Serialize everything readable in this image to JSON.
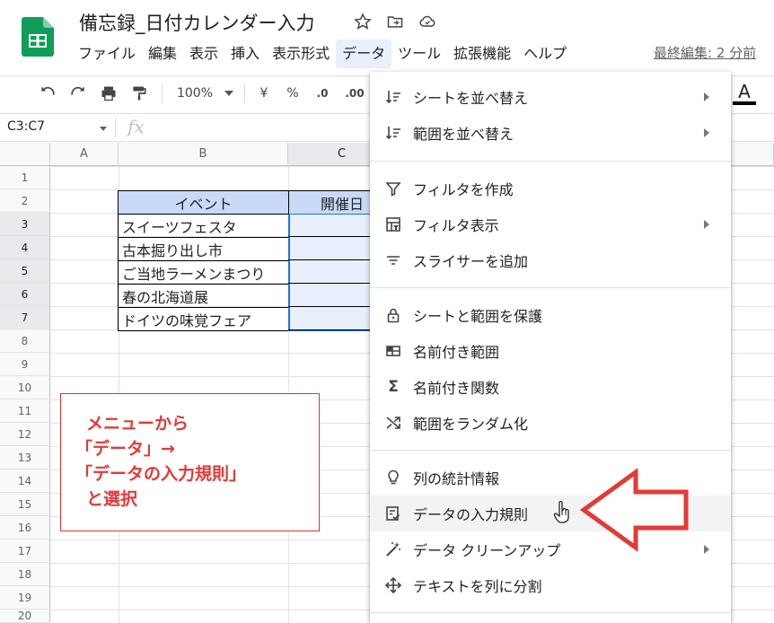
{
  "doc": {
    "title": "備忘録_日付カレンダー入力",
    "last_edit": "最終編集: 2 分前"
  },
  "menubar": [
    "ファイル",
    "編集",
    "表示",
    "挿入",
    "表示形式",
    "データ",
    "ツール",
    "拡張機能",
    "ヘルプ"
  ],
  "toolbar": {
    "zoom": "100%",
    "currency": "¥",
    "percent": "%",
    "dec_decrease": ".0",
    "dec_increase": ".00",
    "text_color": "A"
  },
  "formula_bar": {
    "name_box": "C3:C7",
    "fx": "fx"
  },
  "columns": [
    "A",
    "B",
    "C"
  ],
  "rows": [
    "1",
    "2",
    "3",
    "4",
    "5",
    "6",
    "7",
    "8",
    "9",
    "10",
    "11",
    "12",
    "13",
    "14",
    "15",
    "16",
    "17",
    "18",
    "19",
    "20"
  ],
  "table": {
    "header_b": "イベント",
    "header_c": "開催日",
    "events": [
      "スイーツフェスタ",
      "古本掘り出し市",
      "ご当地ラーメンまつり",
      "春の北海道展",
      "ドイツの味覚フェア"
    ]
  },
  "annotation": [
    "メニューから",
    "「データ」→",
    "「データの入力規則」",
    "と選択"
  ],
  "data_menu": [
    {
      "label": "シートを並べ替え",
      "icon": "sort-icon",
      "submenu": true
    },
    {
      "label": "範囲を並べ替え",
      "icon": "sort-icon",
      "submenu": true
    },
    {
      "label": "フィルタを作成",
      "icon": "filter-icon",
      "submenu": false
    },
    {
      "label": "フィルタ表示",
      "icon": "filter-view-icon",
      "submenu": true
    },
    {
      "label": "スライサーを追加",
      "icon": "slicer-icon",
      "submenu": false
    },
    {
      "label": "シートと範囲を保護",
      "icon": "lock-icon",
      "submenu": false
    },
    {
      "label": "名前付き範囲",
      "icon": "named-range-icon",
      "submenu": false
    },
    {
      "label": "名前付き関数",
      "icon": "sigma-icon",
      "submenu": false
    },
    {
      "label": "範囲をランダム化",
      "icon": "shuffle-icon",
      "submenu": false
    },
    {
      "label": "列の統計情報",
      "icon": "lightbulb-icon",
      "submenu": false
    },
    {
      "label": "データの入力規則",
      "icon": "data-validation-icon",
      "submenu": false
    },
    {
      "label": "データ クリーンアップ",
      "icon": "magic-wand-icon",
      "submenu": true
    },
    {
      "label": "テキストを列に分割",
      "icon": "split-icon",
      "submenu": false
    }
  ],
  "colors": {
    "accent_red": "#e53935",
    "sheets_green": "#0f9d58",
    "header_fill": "#c9daf8",
    "selection_fill": "#e8f0fe",
    "selection_border": "#1a73e8"
  }
}
